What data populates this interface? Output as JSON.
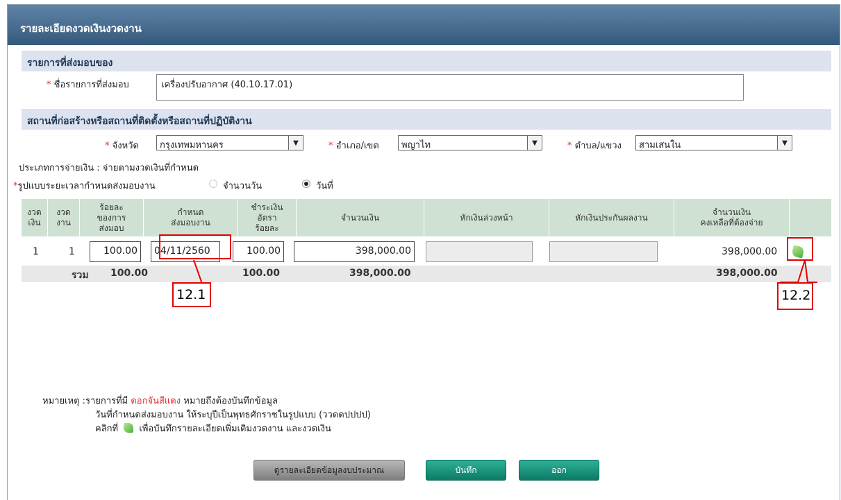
{
  "window": {
    "title": "รายละเอียดงวดเงินงวดงาน"
  },
  "section_item": {
    "title": "รายการที่ส่งมอบของ",
    "label": "ชื่อรายการที่ส่งมอบ",
    "value": "เครื่องปรับอากาศ (40.10.17.01)"
  },
  "section_location": {
    "title": "สถานที่ก่อสร้างหรือสถานที่ติดตั้งหรือสถานที่ปฏิบัติงาน",
    "province_label": "จังหวัด",
    "province_value": "กรุงเทพมหานคร",
    "district_label": "อำเภอ/เขต",
    "district_value": "พญาไท",
    "subdistrict_label": "ตำบล/แขวง",
    "subdistrict_value": "สามเสนใน"
  },
  "payment_type": "ประเภทการจ่ายเงิน : จ่ายตามงวดเงินที่กำหนด",
  "period_format": {
    "label": "รูปแบบระยะเวลากำหนดส่งมอบงาน",
    "option_days": "จำนวนวัน",
    "option_date": "วันที่",
    "selected": "วันที่"
  },
  "required_mark": "*",
  "table": {
    "headers": [
      "งวด\nเงิน",
      "งวด\nงาน",
      "ร้อยละ\nของการ\nส่งมอบ",
      "กำหนด\nส่งมอบงาน",
      "ชำระเงิน\nอัตรา\nร้อยละ",
      "จำนวนเงิน",
      "หักเงินล่วงหน้า",
      "หักเงินประกันผลงาน",
      "จำนวนเงิน\nคงเหลือที่ต้องจ่าย",
      ""
    ],
    "row": {
      "pay_no": "1",
      "work_no": "1",
      "deliver_percent": "100.00",
      "due_date": "04/11/2560",
      "pay_percent": "100.00",
      "amount": "398,000.00",
      "advance": "",
      "guarantee": "",
      "remaining": "398,000.00"
    },
    "total": {
      "label": "รวม",
      "deliver_percent": "100.00",
      "pay_percent": "100.00",
      "amount": "398,000.00",
      "remaining": "398,000.00"
    }
  },
  "callouts": {
    "a": "12.1",
    "b": "12.2"
  },
  "note": {
    "prefix": "หมายเหตุ :รายการที่มี ",
    "red": "ดอกจันสีแดง",
    "suffix": " หมายถึงต้องบันทึกข้อมูล",
    "line2": "วันที่กำหนดส่งมอบงาน ให้ระบุปีเป็นพุทธศักราชในรูปแบบ (ววดดปปปป)",
    "line3_prefix": "คลิกที่",
    "line3_suffix": "เพื่อบันทึกรายละเอียดเพิ่มเติมงวดงาน และงวดเงิน"
  },
  "buttons": {
    "budget": "ดูรายละเอียดข้อมูลงบประมาณ",
    "save": "บันทึก",
    "exit": "ออก"
  },
  "colors": {
    "titlebar": "#4a7092",
    "section": "#dde3ee",
    "table_header": "#cfe1d2",
    "button_green": "#16927c",
    "callout_red": "#e00000"
  }
}
